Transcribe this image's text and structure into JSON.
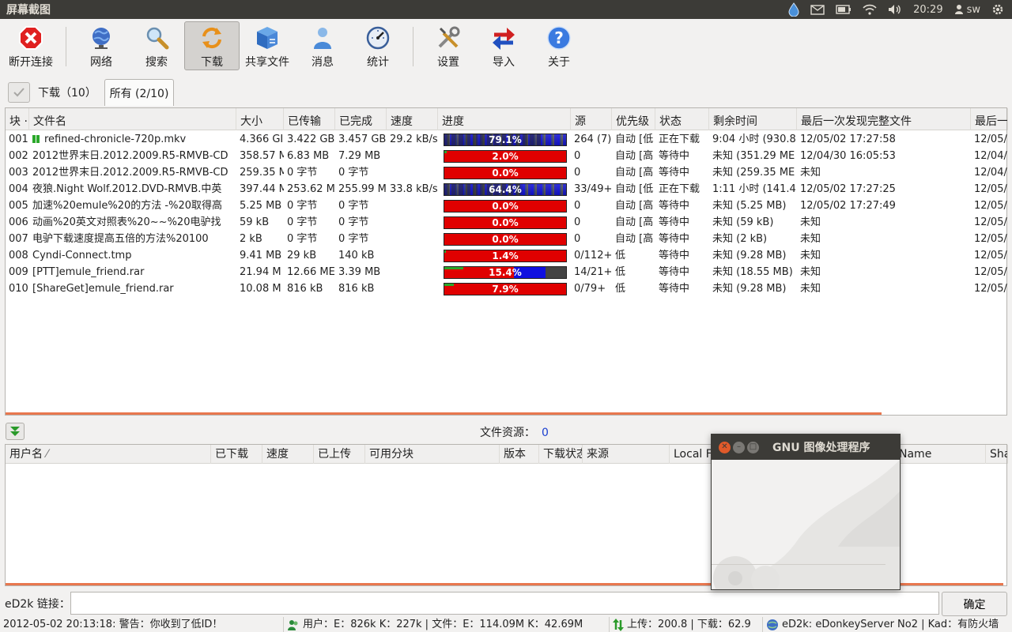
{
  "topbar": {
    "title": "屏幕截图",
    "clock": "20:29",
    "user": "sw",
    "icons": [
      "drop-icon",
      "mail-icon",
      "battery-icon",
      "wifi-icon",
      "volume-icon",
      "user-icon",
      "gear-icon"
    ]
  },
  "toolbar": {
    "items": [
      {
        "label": "断开连接",
        "icon": "disconnect-icon"
      },
      {
        "label": "网络",
        "icon": "globe-icon"
      },
      {
        "label": "搜索",
        "icon": "magnifier-icon"
      },
      {
        "label": "下载",
        "icon": "refresh-arrows-icon",
        "active": true
      },
      {
        "label": "共享文件",
        "icon": "shared-box-icon"
      },
      {
        "label": "消息",
        "icon": "person-icon"
      },
      {
        "label": "统计",
        "icon": "gauge-icon"
      },
      {
        "label": "设置",
        "icon": "tools-icon"
      },
      {
        "label": "导入",
        "icon": "import-arrows-icon"
      },
      {
        "label": "关于",
        "icon": "help-icon"
      }
    ]
  },
  "tabs": {
    "downloads": "下载（10）",
    "all": "所有 (2/10)"
  },
  "downloads": {
    "columns": [
      "块",
      "文件名",
      "大小",
      "已传输",
      "已完成",
      "速度",
      "进度",
      "源",
      "优先级",
      "状态",
      "剩余时间",
      "最后一次发现完整文件",
      "最后一"
    ],
    "rows": [
      {
        "num": "001",
        "name": "refined-chronicle-720p.mkv",
        "size": "4.366 GI",
        "transferred": "3.422 GB",
        "completed": "3.457 GB",
        "speed": "29.2 kB/s",
        "progress": 79.1,
        "pct": "79.1%",
        "style": "striped-blue",
        "sources": "264 (7)",
        "priority": "自动 [低",
        "status": "正在下载",
        "remaining": "9:04 小时 (930.8",
        "last_seen": "12/05/02 17:27:58",
        "last": "12/05/"
      },
      {
        "num": "002",
        "name": "2012世界末日.2012.2009.R5-RMVB-CD",
        "size": "358.57 M",
        "transferred": "6.83 MB",
        "completed": "7.29 MB",
        "speed": "",
        "progress": 2.0,
        "pct": "2.0%",
        "style": "red",
        "sources": "0",
        "priority": "自动 [高",
        "status": "等待中",
        "remaining": "未知 (351.29 ME",
        "last_seen": "12/04/30 16:05:53",
        "last": "12/04/"
      },
      {
        "num": "003",
        "name": "2012世界末日.2012.2009.R5-RMVB-CD",
        "size": "259.35 M",
        "transferred": "0 字节",
        "completed": "0 字节",
        "speed": "",
        "progress": 0.0,
        "pct": "0.0%",
        "style": "red",
        "sources": "0",
        "priority": "自动 [高",
        "status": "等待中",
        "remaining": "未知 (259.35 ME",
        "last_seen": "未知",
        "last": "12/04/"
      },
      {
        "num": "004",
        "name": "夜狼.Night Wolf.2012.DVD-RMVB.中英",
        "size": "397.44 M",
        "transferred": "253.62 M",
        "completed": "255.99 M",
        "speed": "33.8 kB/s",
        "progress": 64.4,
        "pct": "64.4%",
        "style": "striped-blue",
        "sources": "33/49+",
        "priority": "自动 [低",
        "status": "正在下载",
        "remaining": "1:11 小时 (141.4",
        "last_seen": "12/05/02 17:27:25",
        "last": "12/05/"
      },
      {
        "num": "005",
        "name": "加速%20emule%20的方法 -%20取得高",
        "size": "5.25 MB",
        "transferred": "0 字节",
        "completed": "0 字节",
        "speed": "",
        "progress": 0.0,
        "pct": "0.0%",
        "style": "red",
        "sources": "0",
        "priority": "自动 [高",
        "status": "等待中",
        "remaining": "未知 (5.25 MB)",
        "last_seen": "12/05/02 17:27:49",
        "last": "12/05/"
      },
      {
        "num": "006",
        "name": "动画%20英文对照表%20~~%20电驴找",
        "size": "59 kB",
        "transferred": "0 字节",
        "completed": "0 字节",
        "speed": "",
        "progress": 0.0,
        "pct": "0.0%",
        "style": "red",
        "sources": "0",
        "priority": "自动 [高",
        "status": "等待中",
        "remaining": "未知 (59 kB)",
        "last_seen": "未知",
        "last": "12/05/"
      },
      {
        "num": "007",
        "name": "电驴下载速度提高五倍的方法%20100",
        "size": "2 kB",
        "transferred": "0 字节",
        "completed": "0 字节",
        "speed": "",
        "progress": 0.0,
        "pct": "0.0%",
        "style": "red",
        "sources": "0",
        "priority": "自动 [高",
        "status": "等待中",
        "remaining": "未知 (2 kB)",
        "last_seen": "未知",
        "last": "12/05/"
      },
      {
        "num": "008",
        "name": "Cyndi-Connect.tmp",
        "size": "9.41 MB",
        "transferred": "29 kB",
        "completed": "140 kB",
        "speed": "",
        "progress": 1.4,
        "pct": "1.4%",
        "style": "red",
        "sources": "0/112+",
        "priority": "低",
        "status": "等待中",
        "remaining": "未知 (9.28 MB)",
        "last_seen": "未知",
        "last": "12/05/"
      },
      {
        "num": "009",
        "name": "[PTT]emule_friend.rar",
        "size": "21.94 M",
        "transferred": "12.66 ME",
        "completed": "3.39 MB",
        "speed": "",
        "progress": 15.4,
        "pct": "15.4%",
        "style": "red-blue",
        "sources": "14/21+",
        "priority": "低",
        "status": "等待中",
        "remaining": "未知 (18.55 MB)",
        "last_seen": "未知",
        "last": "12/05/"
      },
      {
        "num": "010",
        "name": "[ShareGet]emule_friend.rar",
        "size": "10.08 M",
        "transferred": "816 kB",
        "completed": "816 kB",
        "speed": "",
        "progress": 7.9,
        "pct": "7.9%",
        "style": "red",
        "sources": "0/79+",
        "priority": "低",
        "status": "等待中",
        "remaining": "未知 (9.28 MB)",
        "last_seen": "未知",
        "last": "12/05/"
      }
    ]
  },
  "sources": {
    "caption": "文件资源：",
    "count": "0",
    "columns": [
      "用户名",
      "已下载",
      "速度",
      "已上传",
      "可用分块",
      "版本",
      "下载状态",
      "来源",
      "Local F",
      "Name",
      "Sha"
    ]
  },
  "linkbar": {
    "label": "eD2k 链接：",
    "value": "",
    "confirm": "确定"
  },
  "statusbar": {
    "log": "2012-05-02 20:13:18: 警告：你收到了低ID！",
    "users": "用户：E：826k K：227k | 文件：E：114.09M K：42.69M",
    "rates": "上传：200.8 | 下载：62.9",
    "network": "eD2k: eDonkeyServer No2 | Kad：有防火墙"
  },
  "gimp_window": {
    "title": "GNU 图像处理程序"
  },
  "colors": {
    "panel": "#3c3b37",
    "accent": "#e8774e",
    "progress_red": "#e00000",
    "progress_blue": "#1010e0",
    "link_blue": "#1a3fd0"
  }
}
